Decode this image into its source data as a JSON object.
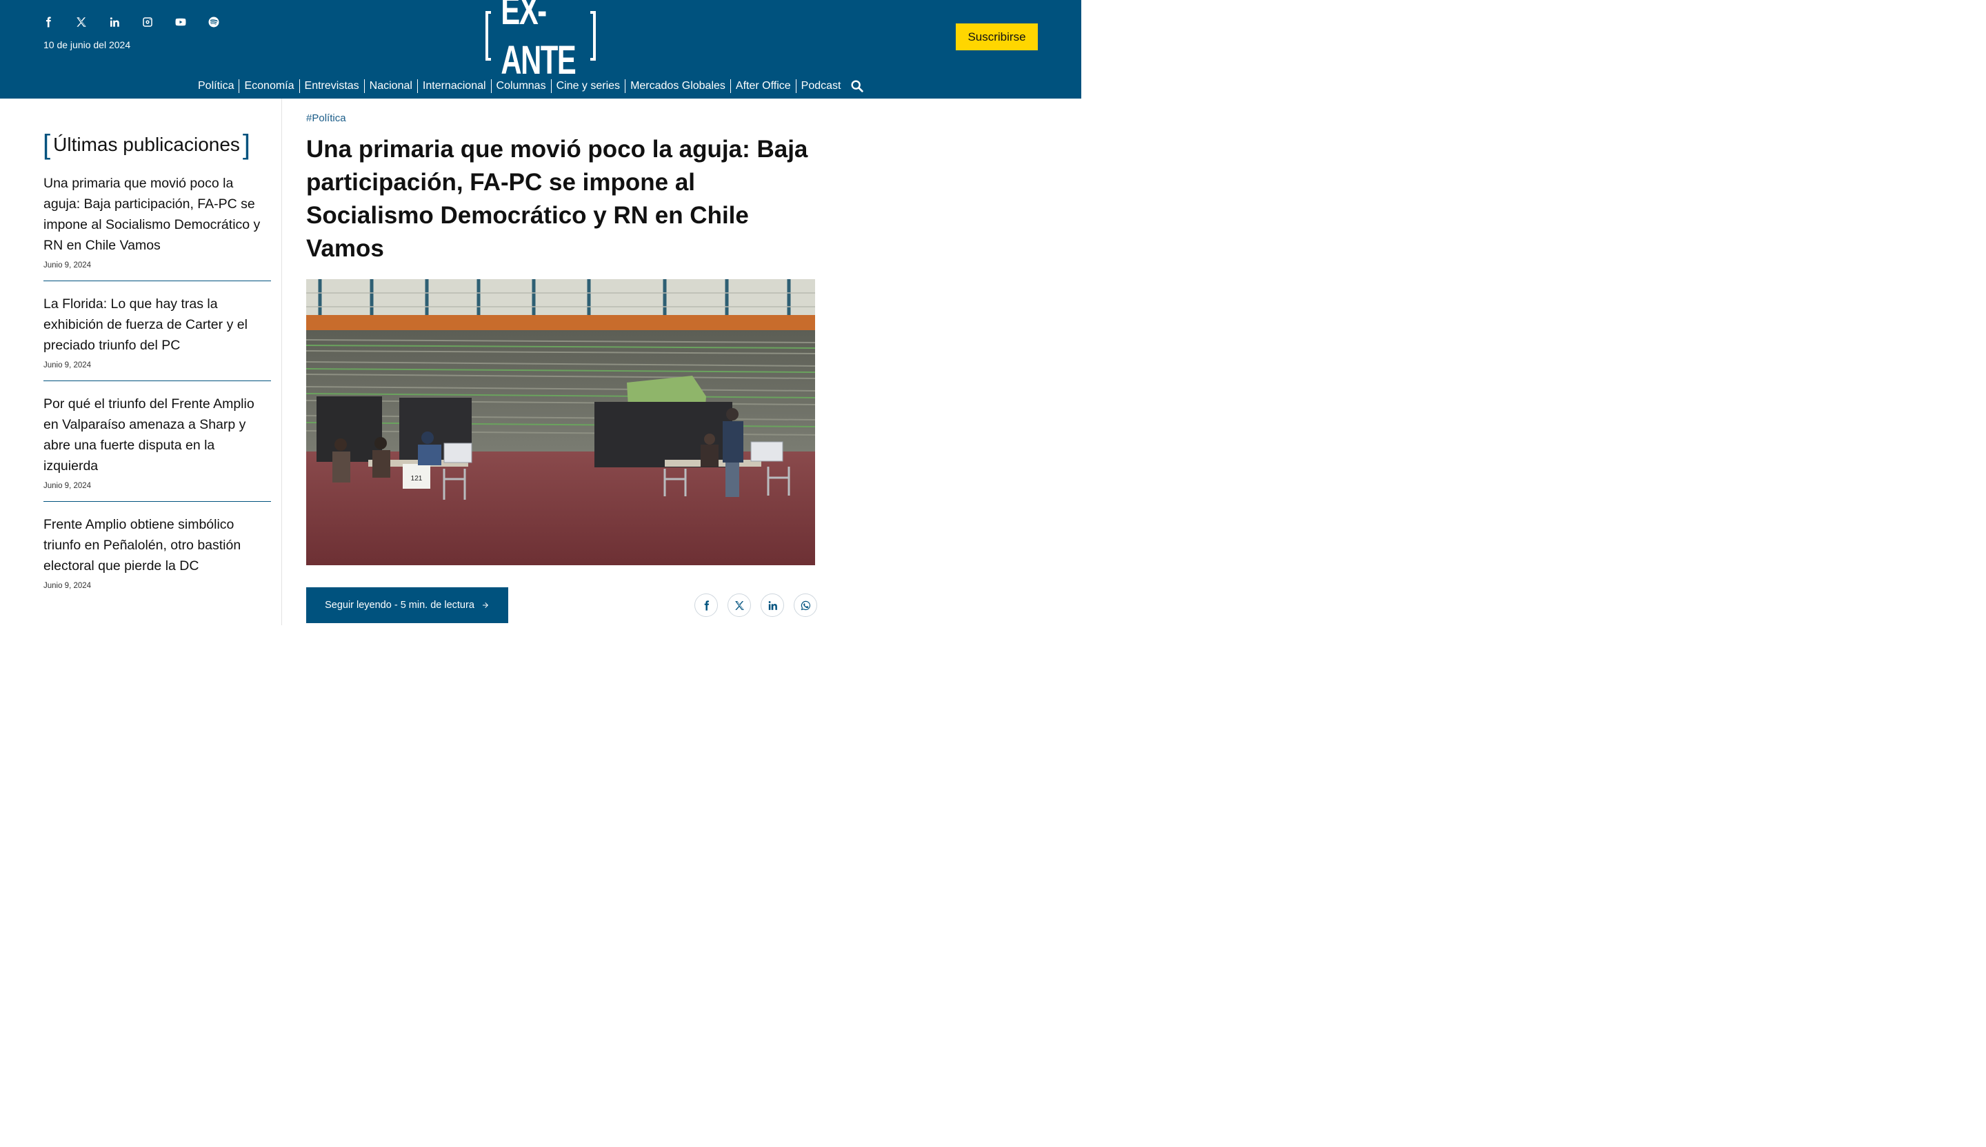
{
  "header": {
    "date": "10 de junio del 2024",
    "logo_text": "EX-ANTE",
    "subscribe_label": "Suscribirse",
    "social_icons": [
      "facebook-icon",
      "x-icon",
      "linkedin-icon",
      "instagram-icon",
      "youtube-icon",
      "spotify-icon"
    ],
    "nav": [
      {
        "label": "Política"
      },
      {
        "label": "Economía"
      },
      {
        "label": "Entrevistas"
      },
      {
        "label": "Nacional"
      },
      {
        "label": "Internacional"
      },
      {
        "label": "Columnas"
      },
      {
        "label": "Cine y series"
      },
      {
        "label": "Mercados Globales"
      },
      {
        "label": "After Office"
      },
      {
        "label": "Podcast"
      }
    ]
  },
  "sidebar": {
    "title": "Últimas publicaciones",
    "items": [
      {
        "title": "Una primaria que movió poco la aguja: Baja participación, FA-PC se impone al Socialismo Democrático y RN en Chile Vamos",
        "date": "Junio 9, 2024"
      },
      {
        "title": "La Florida: Lo que hay tras la exhibición de fuerza de Carter y el preciado triunfo del PC",
        "date": "Junio 9, 2024"
      },
      {
        "title": "Por qué el triunfo del Frente Amplio en Valparaíso amenaza a Sharp y abre una fuerte disputa en la izquierda",
        "date": "Junio 9, 2024"
      },
      {
        "title": "Frente Amplio obtiene simbólico triunfo en Peñalolén, otro bastión electoral que pierde la DC",
        "date": "Junio 9, 2024"
      }
    ]
  },
  "article": {
    "tag": "#Política",
    "headline": "Una primaria que movió poco la aguja: Baja participación, FA-PC se impone al Socialismo Democrático y RN en Chile Vamos",
    "photo_sign_text": "121",
    "read_more_label": "Seguir leyendo - 5 min. de lectura",
    "share_icons": [
      "facebook-icon",
      "x-icon",
      "linkedin-icon",
      "whatsapp-icon"
    ]
  },
  "colors": {
    "brand_blue": "#00527e",
    "subscribe_yellow": "#ffd600"
  }
}
